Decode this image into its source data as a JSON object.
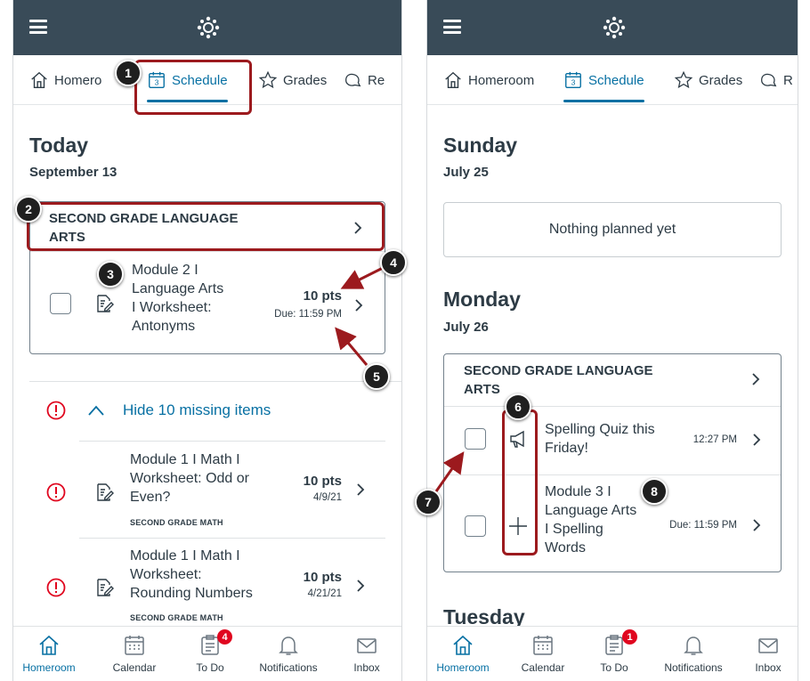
{
  "colors": {
    "topbar": "#394b58",
    "accent": "#0770a3",
    "annotation": "#9c1a1e",
    "alert": "#e0061f"
  },
  "tabs": {
    "homeroom_left": "Homero",
    "homeroom": "Homeroom",
    "schedule": "Schedule",
    "grades": "Grades",
    "resources_left": "Re",
    "resources_right": "R"
  },
  "left": {
    "day_title": "Today",
    "day_date": "September 13",
    "course_title_line1": "SECOND GRADE LANGUAGE",
    "course_title_line2": "ARTS",
    "item": {
      "title_lines": [
        "Module 2 I",
        "Language Arts",
        "I Worksheet:",
        "Antonyms"
      ],
      "points": "10 pts",
      "due": "Due: 11:59 PM"
    },
    "missing_toggle": "Hide 10 missing items",
    "missing_items": [
      {
        "title_lines": [
          "Module 1 I Math I",
          "Worksheet: Odd or",
          "Even?"
        ],
        "points": "10 pts",
        "date": "4/9/21",
        "course": "SECOND GRADE MATH"
      },
      {
        "title_lines": [
          "Module 1 I Math I",
          "Worksheet:",
          "Rounding Numbers"
        ],
        "points": "10 pts",
        "date": "4/21/21",
        "course": "SECOND GRADE MATH"
      }
    ]
  },
  "right": {
    "sunday_title": "Sunday",
    "sunday_date": "July 25",
    "empty_text": "Nothing planned yet",
    "monday_title": "Monday",
    "monday_date": "July 26",
    "course_title_line1": "SECOND GRADE LANGUAGE",
    "course_title_line2": "ARTS",
    "items": [
      {
        "title_lines": [
          "Spelling Quiz this",
          "Friday!"
        ],
        "time": "12:27 PM"
      },
      {
        "title_lines": [
          "Module 3 I",
          "Language Arts",
          "I Spelling",
          "Words"
        ],
        "time": "Due: 11:59 PM"
      }
    ],
    "next_day_title": "Tuesday"
  },
  "bottom_nav": {
    "homeroom": "Homeroom",
    "calendar": "Calendar",
    "todo": "To Do",
    "notifications": "Notifications",
    "inbox": "Inbox",
    "todo_badge_left": "4",
    "todo_badge_right": "1"
  },
  "markers": [
    "1",
    "2",
    "3",
    "4",
    "5",
    "6",
    "7",
    "8"
  ]
}
